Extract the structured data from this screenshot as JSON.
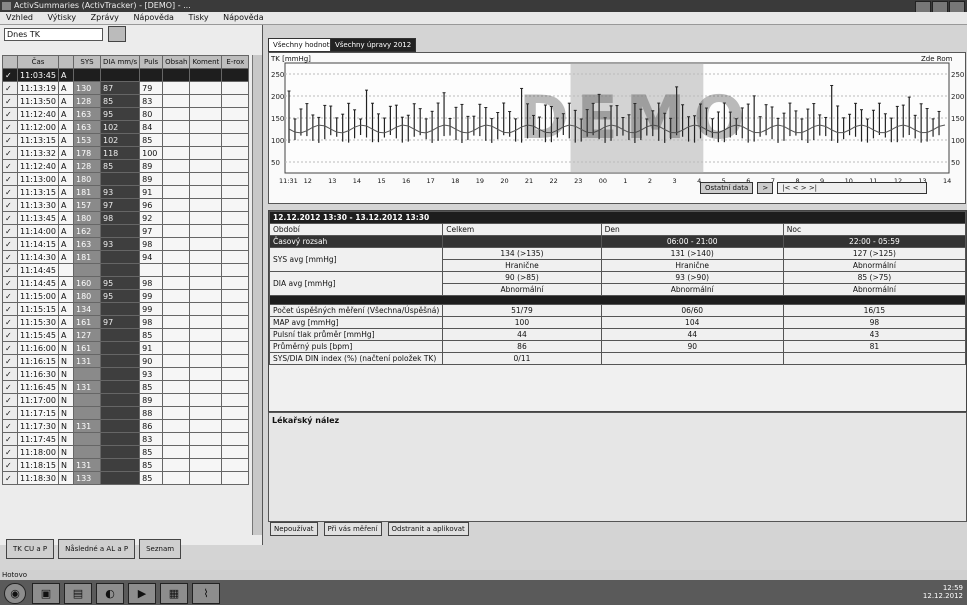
{
  "window": {
    "title": "ActivSummaries (ActivTracker) - [DEMO] - ...",
    "icon": "app-icon"
  },
  "menu": [
    "Vzhled",
    "Výtisky",
    "Zprávy",
    "Nápověda",
    "Tisky",
    "Nápověda"
  ],
  "left": {
    "dropdown_value": "Dnes TK",
    "headers": [
      "",
      "Čas",
      "",
      "SYS",
      "DIA mm/s",
      "Puls",
      "Obsah",
      "Koment",
      "E-rox"
    ],
    "rows": [
      {
        "time": "11:03:45",
        "m": "A",
        "sys": "",
        "dia": "",
        "puls": "",
        "sel": true
      },
      {
        "time": "11:13:19",
        "m": "A",
        "sys": "130",
        "dia": "87",
        "puls": "79"
      },
      {
        "time": "11:13:50",
        "m": "A",
        "sys": "128",
        "dia": "85",
        "puls": "83"
      },
      {
        "time": "11:12:40",
        "m": "A",
        "sys": "163",
        "dia": "95",
        "puls": "80"
      },
      {
        "time": "11:12:00",
        "m": "A",
        "sys": "163",
        "dia": "102",
        "puls": "84"
      },
      {
        "time": "11:13:15",
        "m": "A",
        "sys": "153",
        "dia": "102",
        "puls": "85"
      },
      {
        "time": "11:13:32",
        "m": "A",
        "sys": "178",
        "dia": "118",
        "puls": "100"
      },
      {
        "time": "11:12:40",
        "m": "A",
        "sys": "128",
        "dia": "85",
        "puls": "89"
      },
      {
        "time": "11:13:00",
        "m": "A",
        "sys": "180",
        "dia": "",
        "puls": "89"
      },
      {
        "time": "11:13:15",
        "m": "A",
        "sys": "181",
        "dia": "93",
        "puls": "91"
      },
      {
        "time": "11:13:30",
        "m": "A",
        "sys": "157",
        "dia": "97",
        "puls": "96"
      },
      {
        "time": "11:13:45",
        "m": "A",
        "sys": "180",
        "dia": "98",
        "puls": "92"
      },
      {
        "time": "11:14:00",
        "m": "A",
        "sys": "162",
        "dia": "",
        "puls": "97"
      },
      {
        "time": "11:14:15",
        "m": "A",
        "sys": "163",
        "dia": "93",
        "puls": "98"
      },
      {
        "time": "11:14:30",
        "m": "A",
        "sys": "181",
        "dia": "",
        "puls": "94"
      },
      {
        "time": "11:14:45",
        "m": "",
        "sys": "",
        "dia": "",
        "puls": ""
      },
      {
        "time": "11:14:45",
        "m": "A",
        "sys": "160",
        "dia": "95",
        "puls": "98"
      },
      {
        "time": "11:15:00",
        "m": "A",
        "sys": "180",
        "dia": "95",
        "puls": "99"
      },
      {
        "time": "11:15:15",
        "m": "A",
        "sys": "134",
        "dia": "",
        "puls": "99"
      },
      {
        "time": "11:15:30",
        "m": "A",
        "sys": "161",
        "dia": "97",
        "puls": "98"
      },
      {
        "time": "11:15:45",
        "m": "A",
        "sys": "127",
        "dia": "",
        "puls": "85"
      },
      {
        "time": "11:16:00",
        "m": "N",
        "sys": "161",
        "dia": "",
        "puls": "91"
      },
      {
        "time": "11:16:15",
        "m": "N",
        "sys": "131",
        "dia": "",
        "puls": "90"
      },
      {
        "time": "11:16:30",
        "m": "N",
        "sys": "",
        "dia": "",
        "puls": "93"
      },
      {
        "time": "11:16:45",
        "m": "N",
        "sys": "131",
        "dia": "",
        "puls": "85"
      },
      {
        "time": "11:17:00",
        "m": "N",
        "sys": "",
        "dia": "",
        "puls": "89"
      },
      {
        "time": "11:17:15",
        "m": "N",
        "sys": "",
        "dia": "",
        "puls": "88"
      },
      {
        "time": "11:17:30",
        "m": "N",
        "sys": "131",
        "dia": "",
        "puls": "86"
      },
      {
        "time": "11:17:45",
        "m": "N",
        "sys": "",
        "dia": "",
        "puls": "83"
      },
      {
        "time": "11:18:00",
        "m": "N",
        "sys": "",
        "dia": "",
        "puls": "85"
      },
      {
        "time": "11:18:15",
        "m": "N",
        "sys": "131",
        "dia": "",
        "puls": "85"
      },
      {
        "time": "11:18:30",
        "m": "N",
        "sys": "133",
        "dia": "",
        "puls": "85"
      }
    ],
    "buttons": [
      "TK CU a P",
      "Nåsledné a AL a P",
      "Seznam"
    ]
  },
  "tabs": [
    "Všechny hodnoty",
    "Všechny úpravy 2012"
  ],
  "chart_label": "TK [mmHg]",
  "chart_right_label": "Zde Rom",
  "yticks": [
    "250",
    "200",
    "150",
    "100",
    "50"
  ],
  "xticks": [
    "11:31",
    "12",
    "13",
    "14",
    "15",
    "16",
    "17",
    "18",
    "19",
    "20",
    "21",
    "22",
    "23",
    "00",
    "1",
    "2",
    "3",
    "4",
    "5",
    "6",
    "7",
    "8",
    "9",
    "10",
    "11",
    "12",
    "13",
    "14"
  ],
  "nav": {
    "label": "Ostatní data",
    "btn": ">",
    "pager": "|< <  > >|"
  },
  "watermark": "DEMO",
  "summary": {
    "range": "12.12.2012 13:30 - 13.12.2012 13:30",
    "head": [
      "Období",
      "Celkem",
      "Den",
      "Noc"
    ],
    "time_row": [
      "Časový rozsah",
      "",
      "06:00 - 21:00",
      "22:00 - 05:59"
    ],
    "sys_label": "SYS avg [mmHg]",
    "sys_vals": [
      "134 (>135)",
      "131 (>140)",
      "127 (>125)"
    ],
    "sys_sub": [
      "Hranične",
      "Hranične",
      "Abnormální"
    ],
    "dia_label": "DIA avg [mmHg]",
    "dia_vals": [
      "90 (>85)",
      "93 (>90)",
      "85 (>75)"
    ],
    "dia_sub": [
      "Abnormální",
      "Abnormální",
      "Abnormální"
    ],
    "rows": [
      {
        "label": "Počet úspěšných měření (Všechna/Úspěšná)",
        "vals": [
          "51/79",
          "06/60",
          "16/15"
        ]
      },
      {
        "label": "MAP avg [mmHg]",
        "vals": [
          "100",
          "104",
          "98"
        ]
      },
      {
        "label": "Pulsní tlak průměr [mmHg]",
        "vals": [
          "44",
          "44",
          "43"
        ]
      },
      {
        "label": "Průměrný puls [bpm]",
        "vals": [
          "86",
          "90",
          "81"
        ]
      },
      {
        "label": "SYS/DIA DIN index (%) (načtení položek TK)",
        "vals": [
          "0/11",
          "",
          ""
        ]
      }
    ]
  },
  "lekar": "Lékařský nález",
  "radios": [
    "Nepoužívat",
    "Při vás měření",
    "Odstranit a aplikovat"
  ],
  "status": "Hotovo",
  "clock": {
    "time": "12:59",
    "date": "12.12.2012"
  }
}
